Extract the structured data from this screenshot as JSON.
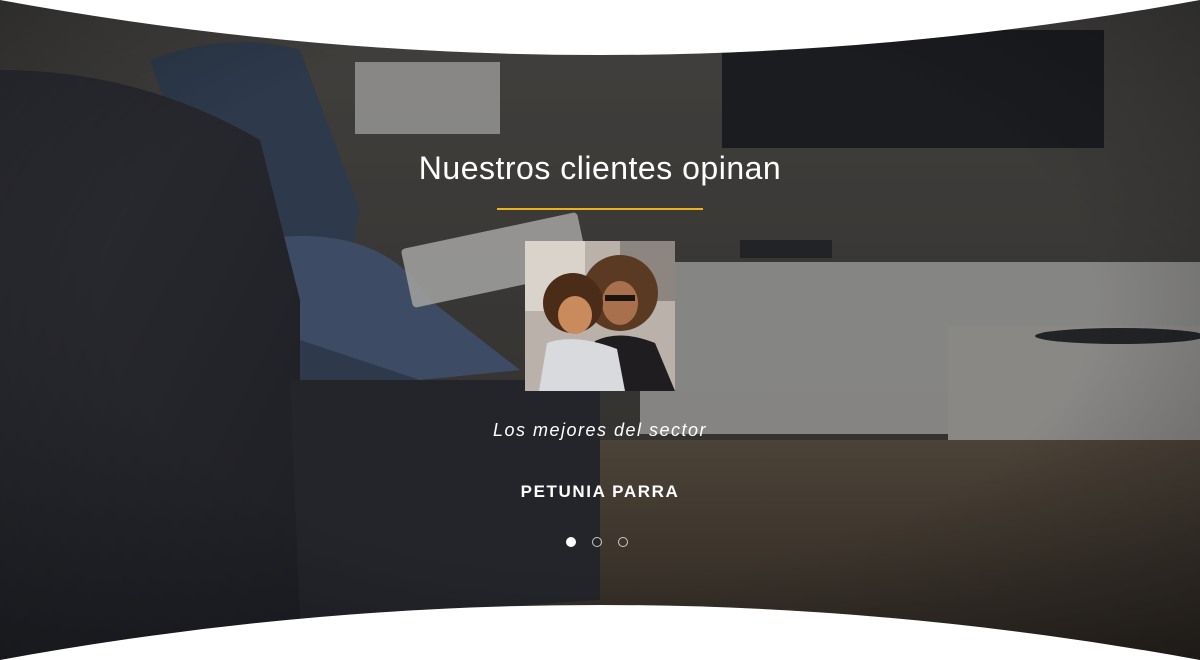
{
  "testimonials": {
    "heading": "Nuestros clientes opinan",
    "accent_color": "#e7b51b",
    "active": {
      "avatar": "mother-and-child-photo",
      "quote": "Los mejores del sector",
      "author": "PETUNIA PARRA"
    },
    "pagination": {
      "count": 3,
      "active_index": 0
    }
  },
  "background": {
    "scene": "living-room-photo"
  }
}
